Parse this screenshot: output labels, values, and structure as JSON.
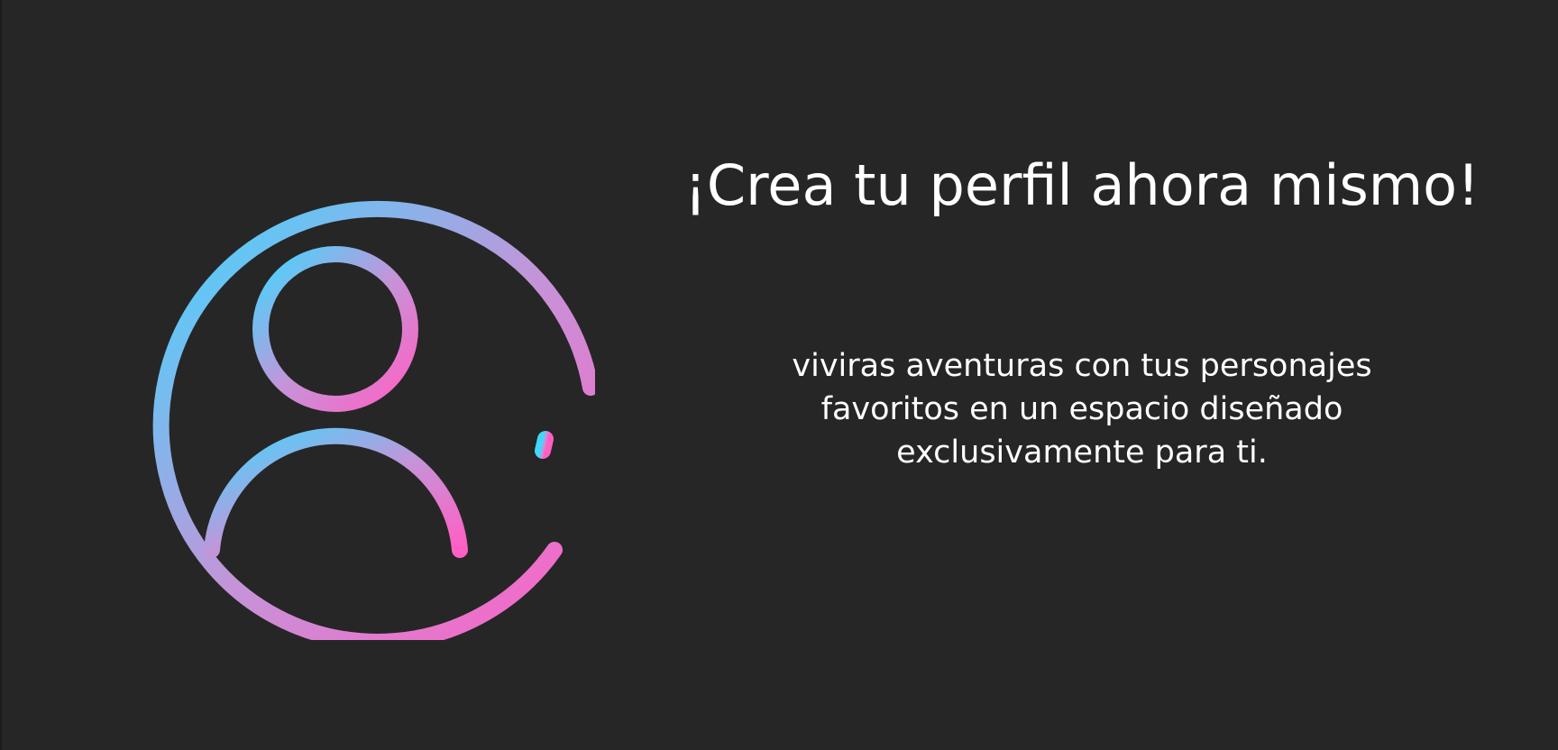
{
  "hero": {
    "title": "¡Crea tu perfil ahora mismo!",
    "description": "viviras aventuras con tus personajes favoritos en un espacio diseñado exclusivamente para ti.",
    "icon": "user-profile-icon"
  },
  "colors": {
    "background": "#262626",
    "text": "#ffffff",
    "gradient_start": "#3fd8ff",
    "gradient_mid": "#c594d8",
    "gradient_end": "#ff5fc3"
  }
}
